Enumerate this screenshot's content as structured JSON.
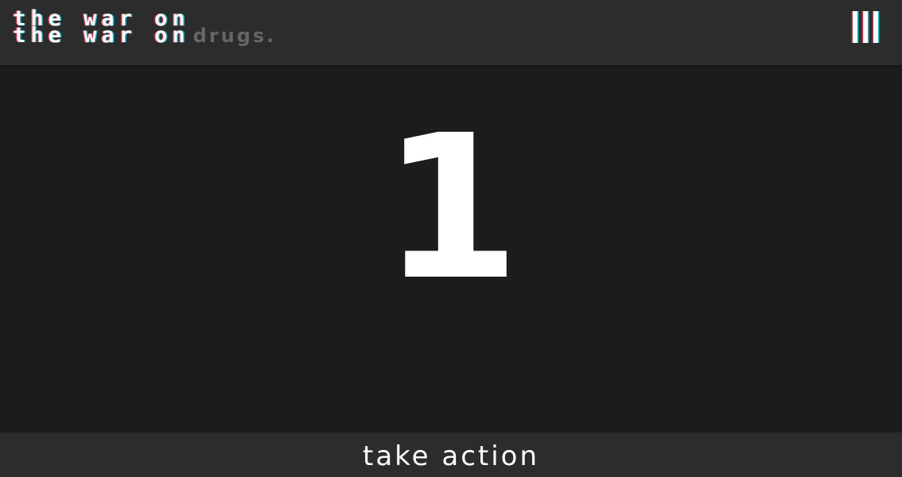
{
  "header": {
    "logo_line_1": "the war on",
    "logo_line_2": "the war on",
    "logo_suffix": "drugs.",
    "menu_icon": "hamburger-menu-icon"
  },
  "main": {
    "counter_value": "1"
  },
  "footer": {
    "action_label": "take action"
  },
  "colors": {
    "background": "#1c1c1c",
    "bar_background": "#2c2c2c",
    "text": "#ffffff",
    "muted_text": "#666666",
    "glitch_red": "#ff283c",
    "glitch_cyan": "#00dcff"
  }
}
